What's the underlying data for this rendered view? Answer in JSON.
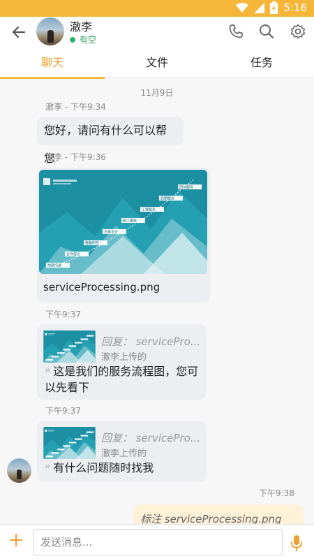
{
  "status_bar": {
    "time": "5:16",
    "background": "#f5b63a"
  },
  "header": {
    "contact_name": "澈李",
    "presence": "有空",
    "icons": [
      "back-arrow-icon",
      "phone-icon",
      "search-icon",
      "settings-icon"
    ]
  },
  "tabs": [
    {
      "label": "聊天",
      "active": true
    },
    {
      "label": "文件",
      "active": false
    },
    {
      "label": "任务",
      "active": false
    }
  ],
  "chat": {
    "date_divider": "11月9日",
    "messages": [
      {
        "sender": "澈李 - 下午9:34",
        "text": "您好，请问有什么可以帮您"
      },
      {
        "sender": "澈李 - 下午9:36",
        "filename": "serviceProcessing.png"
      },
      {
        "time": "下午9:37",
        "reply_title": "回复： servicePro...",
        "reply_sub": "澈李上传的",
        "text": "这是我们的服务流程图，您可以先看下"
      },
      {
        "time": "下午9:37",
        "reply_title": "回复： servicePro...",
        "reply_sub": "澈李上传的",
        "text": "有什么问题随时找我"
      },
      {
        "time": "下午9:38",
        "text": "标注 serviceProcessing.png"
      }
    ],
    "image_steps": [
      "前期沟通",
      "合作签约",
      "策略研究",
      "方案设计",
      "施工图纸",
      "工程服务",
      "后期服务",
      "回访服务"
    ]
  },
  "input": {
    "placeholder": "发送消息..."
  },
  "colors": {
    "accent": "#f5b63a",
    "accent_text": "#f0a030",
    "presence": "#2fb36b",
    "bubble_in": "#eceef1",
    "bubble_out": "#fdf1d8"
  }
}
